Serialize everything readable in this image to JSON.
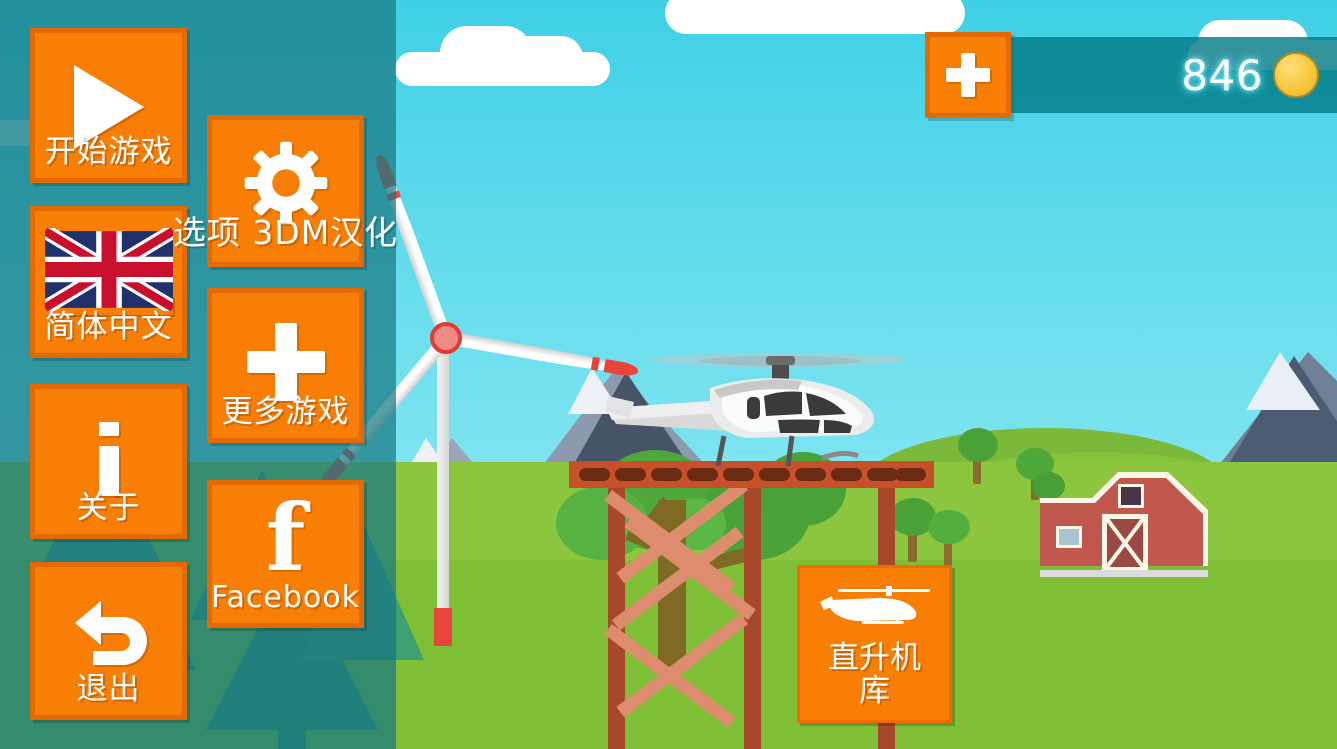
{
  "app": {
    "title": "Helicopter Game Main Menu"
  },
  "colors": {
    "orange": "#f87e06",
    "orange_border": "#e26a00",
    "teal_overlay": "#177882",
    "sky": "#4fd6e6",
    "grass": "#8cc63e",
    "barn_red": "#c0584e",
    "coin_gold": "#f6c83c",
    "coin_text_glow": "#82f5ff"
  },
  "menu": {
    "left_column": [
      {
        "id": "start-game",
        "label": "开始游戏",
        "icon": "play-icon"
      },
      {
        "id": "language",
        "label": "简体中文",
        "icon": "uk-flag-icon"
      },
      {
        "id": "about",
        "label": "关于",
        "icon": "info-icon"
      },
      {
        "id": "exit",
        "label": "退出",
        "icon": "back-arrow-icon"
      }
    ],
    "right_column": [
      {
        "id": "options",
        "label": "选项 3DM汉化",
        "icon": "gear-icon"
      },
      {
        "id": "more-games",
        "label": "更多游戏",
        "icon": "plus-icon"
      },
      {
        "id": "facebook",
        "label": "Facebook",
        "icon": "facebook-icon"
      }
    ]
  },
  "currency": {
    "amount": "846",
    "add_icon": "plus-icon",
    "coin_icon": "coin-icon"
  },
  "hangar": {
    "label_line1": "直升机",
    "label_line2": "库",
    "icon": "helicopter-icon"
  },
  "scene": {
    "sky_label": "sky",
    "objects": [
      "cloud",
      "cloud",
      "cloud",
      "windmill",
      "mountain",
      "mountain",
      "mountain",
      "helicopter",
      "landing-platform",
      "barn",
      "tree",
      "pine-tree",
      "hill"
    ]
  }
}
